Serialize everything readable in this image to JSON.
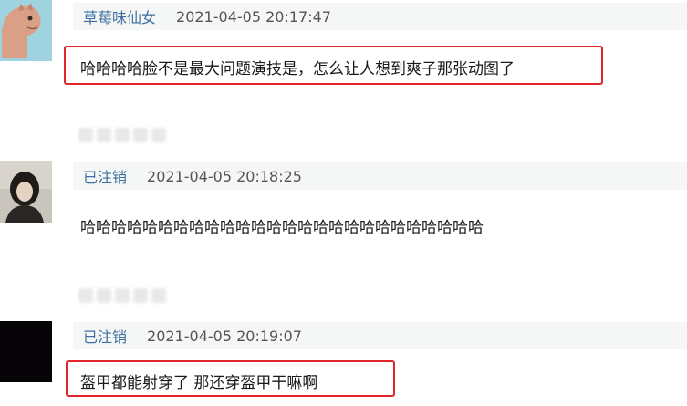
{
  "comments": [
    {
      "username": "草莓味仙女",
      "timestamp": "2021-04-05 20:17:47",
      "text": "哈哈哈哈脸不是最大问题演技是，怎么让人想到爽子那张动图了",
      "highlighted": true,
      "avatar": "dinosaur-avatar"
    },
    {
      "username": "已注销",
      "timestamp": "2021-04-05 20:18:25",
      "text": "哈哈哈哈哈哈哈哈哈哈哈哈哈哈哈哈哈哈哈哈哈哈哈哈哈哈",
      "highlighted": false,
      "avatar": "photo-avatar"
    },
    {
      "username": "已注销",
      "timestamp": "2021-04-05 20:19:07",
      "text": "盔甲都能射穿了 那还穿盔甲干嘛啊",
      "highlighted": true,
      "avatar": "dark-avatar"
    }
  ],
  "colors": {
    "highlight": "#e0262a",
    "username": "#3e6fa0",
    "meta_bg": "#f4f7f5"
  }
}
